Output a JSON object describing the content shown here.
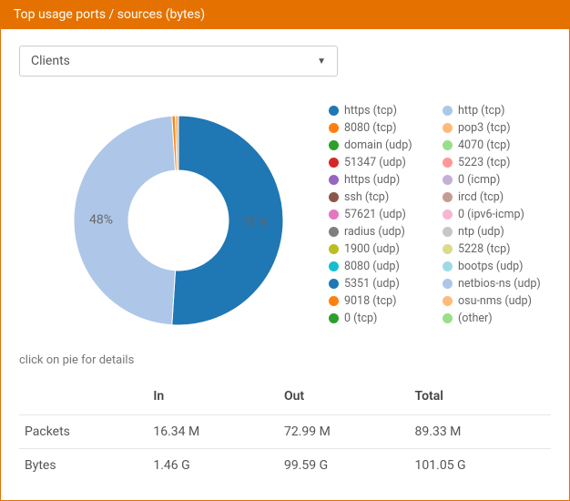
{
  "header": {
    "title": "Top usage ports / sources (bytes)"
  },
  "selector": {
    "value": "Clients"
  },
  "hint": "click on pie for details",
  "chart_data": {
    "type": "pie",
    "title": "Top usage ports / sources (bytes)",
    "series": [
      {
        "name": "https (tcp)",
        "color": "#1f77b4",
        "value": 51,
        "label": "51%"
      },
      {
        "name": "http (tcp)",
        "color": "#aec7e8",
        "value": 48,
        "label": "48%"
      },
      {
        "name": "8080 (tcp)",
        "color": "#ff7f0e",
        "value": 0.5
      },
      {
        "name": "pop3 (tcp)",
        "color": "#ffbb78",
        "value": 0.5
      },
      {
        "name": "domain (udp)",
        "color": "#2ca02c",
        "value": 0
      },
      {
        "name": "4070 (tcp)",
        "color": "#98df8a",
        "value": 0
      },
      {
        "name": "51347 (udp)",
        "color": "#d62728",
        "value": 0
      },
      {
        "name": "5223 (tcp)",
        "color": "#ff9896",
        "value": 0
      },
      {
        "name": "https (udp)",
        "color": "#9467bd",
        "value": 0
      },
      {
        "name": "0 (icmp)",
        "color": "#c5b0d5",
        "value": 0
      },
      {
        "name": "ssh (tcp)",
        "color": "#8c564b",
        "value": 0
      },
      {
        "name": "ircd (tcp)",
        "color": "#c49c94",
        "value": 0
      },
      {
        "name": "57621 (udp)",
        "color": "#e377c2",
        "value": 0
      },
      {
        "name": "0 (ipv6-icmp)",
        "color": "#f7b6d2",
        "value": 0
      },
      {
        "name": "radius (udp)",
        "color": "#7f7f7f",
        "value": 0
      },
      {
        "name": "ntp (udp)",
        "color": "#c7c7c7",
        "value": 0
      },
      {
        "name": "1900 (udp)",
        "color": "#bcbd22",
        "value": 0
      },
      {
        "name": "5228 (tcp)",
        "color": "#dbdb8d",
        "value": 0
      },
      {
        "name": "8080 (udp)",
        "color": "#17becf",
        "value": 0
      },
      {
        "name": "bootps (udp)",
        "color": "#9edae5",
        "value": 0
      },
      {
        "name": "5351 (udp)",
        "color": "#1f77b4",
        "value": 0
      },
      {
        "name": "netbios-ns (udp)",
        "color": "#aec7e8",
        "value": 0
      },
      {
        "name": "9018 (tcp)",
        "color": "#ff7f0e",
        "value": 0
      },
      {
        "name": "osu-nms (udp)",
        "color": "#ffbb78",
        "value": 0
      },
      {
        "name": "0 (tcp)",
        "color": "#2ca02c",
        "value": 0
      },
      {
        "name": "(other)",
        "color": "#98df8a",
        "value": 0
      }
    ]
  },
  "table": {
    "headers": {
      "blank": "",
      "in": "In",
      "out": "Out",
      "total": "Total"
    },
    "rows": [
      {
        "label": "Packets",
        "in": "16.34 M",
        "out": "72.99 M",
        "total": "89.33 M"
      },
      {
        "label": "Bytes",
        "in": "1.46 G",
        "out": "99.59 G",
        "total": "101.05 G"
      }
    ]
  }
}
